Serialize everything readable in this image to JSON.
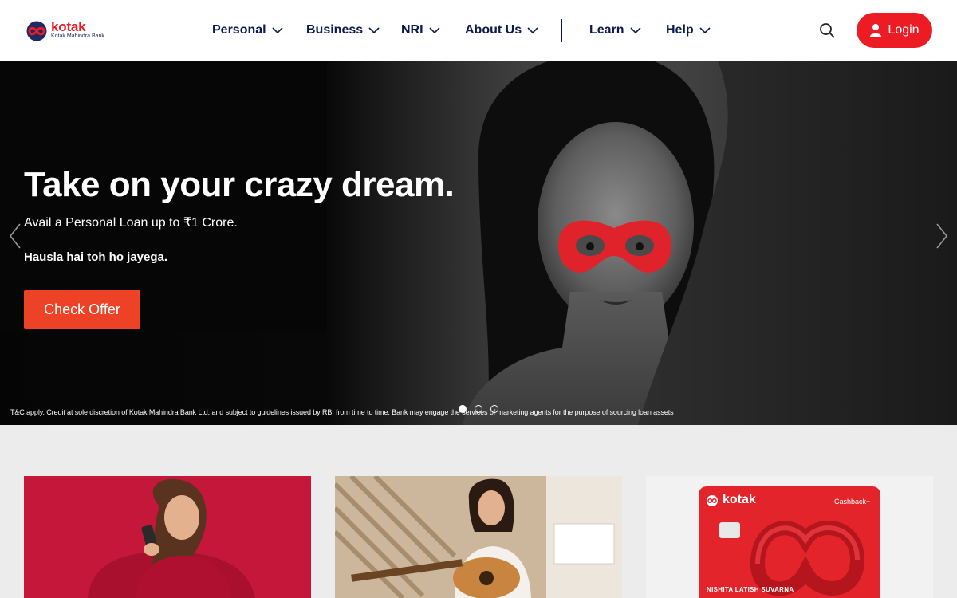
{
  "header": {
    "logo": {
      "wordmark": "kotak",
      "subtitle": "Kotak Mahindra Bank"
    },
    "nav": [
      {
        "label": "Personal"
      },
      {
        "label": "Business"
      },
      {
        "label": "NRI"
      },
      {
        "label": "About Us"
      },
      {
        "label": "Learn"
      },
      {
        "label": "Help"
      }
    ],
    "search_icon": "search-icon",
    "login_label": "Login",
    "login_icon": "user-icon"
  },
  "hero": {
    "title": "Take on your crazy dream.",
    "subtitle": "Avail a Personal Loan up to ₹1 Crore.",
    "tagline": "Hausla hai toh ho jayega.",
    "cta_label": "Check Offer",
    "disclaimer": "T&C apply. Credit at sole discretion of Kotak Mahindra Bank Ltd. and subject to guidelines issued by RBI from time to time. Bank may engage the services of marketing agents for the purpose of sourcing loan assets",
    "slides": {
      "count": 3,
      "active": 1
    }
  },
  "cards": [
    {
      "image": "woman-with-phone-photo"
    },
    {
      "image": "woman-playing-guitar-photo"
    },
    {
      "image": "credit-card-image",
      "card_brand": "kotak",
      "card_type": "Cashback+",
      "card_holder": "NISHITA LATISH SUVARNA"
    }
  ],
  "colors": {
    "brand_red": "#ed1c24",
    "nav_navy": "#0a1a4f",
    "cta_orange": "#ed4226",
    "section_bg": "#ececec"
  }
}
